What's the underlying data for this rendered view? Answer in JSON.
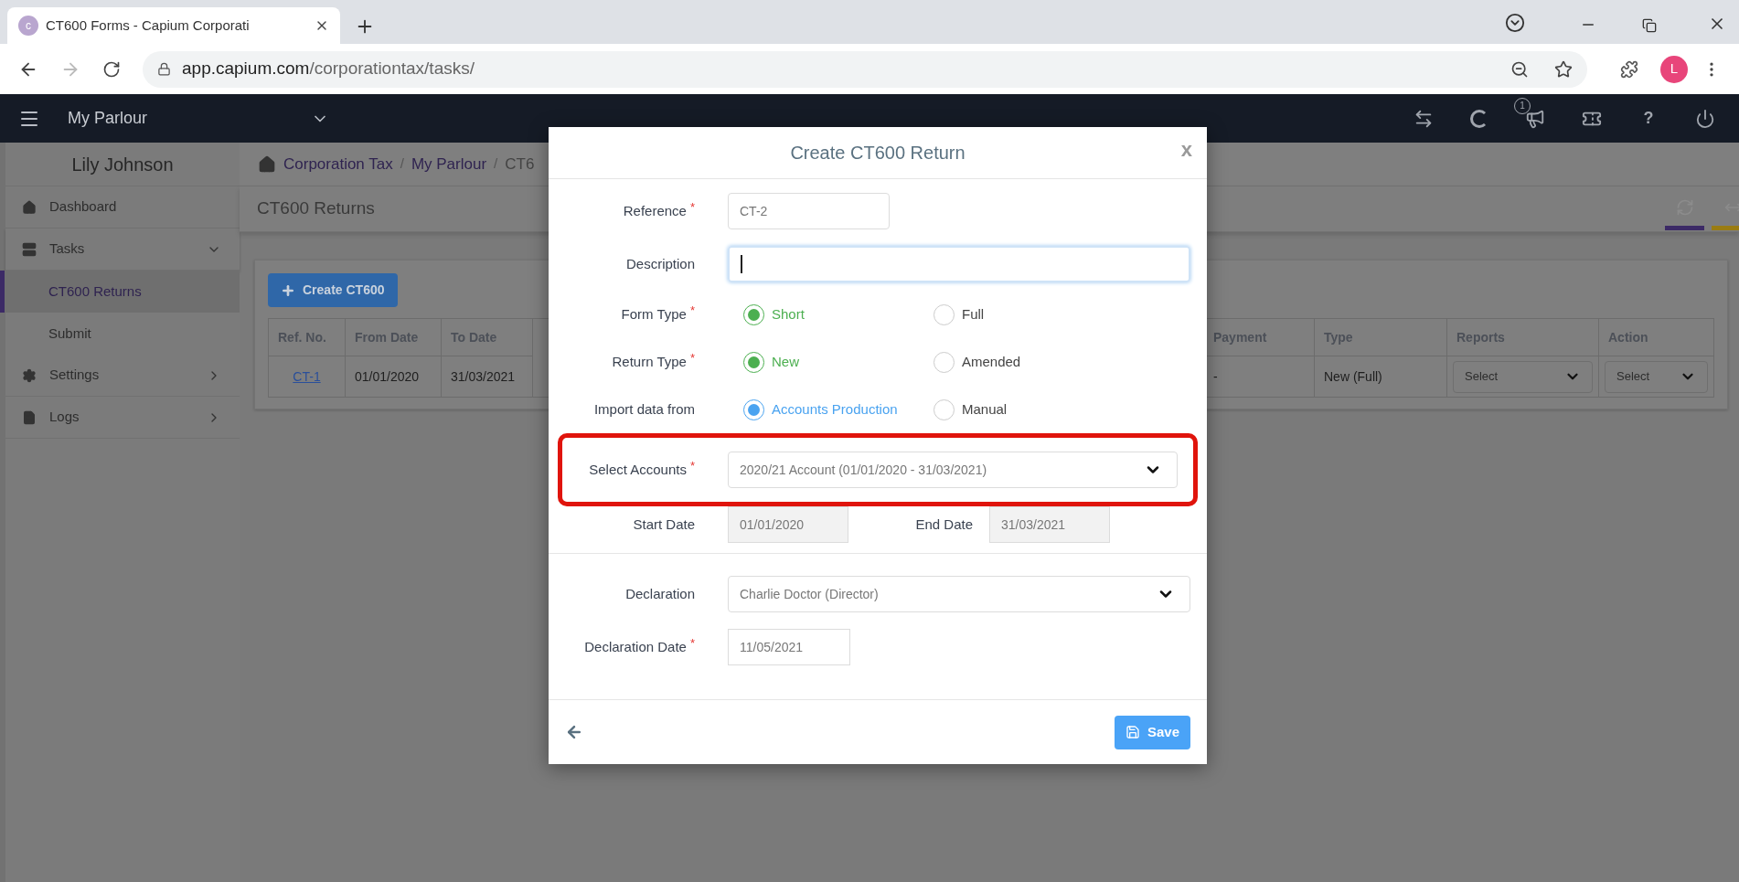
{
  "browser": {
    "tab_title": "CT600 Forms - Capium Corporati",
    "favicon_letter": "c",
    "address_domain": "app.capium.com",
    "address_path": "/corporationtax/tasks/",
    "profile_initial": "L"
  },
  "navbar": {
    "title": "My Parlour",
    "notification_count": "1",
    "help_label": "?"
  },
  "sidebar": {
    "user": "Lily Johnson",
    "items": [
      {
        "kind": "link",
        "label": "Dashboard"
      },
      {
        "kind": "group",
        "label": "Tasks",
        "expanded": true,
        "children": [
          {
            "label": "CT600 Returns",
            "selected": true
          },
          {
            "label": "Submit",
            "selected": false
          }
        ]
      },
      {
        "kind": "group",
        "label": "Settings",
        "expanded": false
      },
      {
        "kind": "group",
        "label": "Logs",
        "expanded": false
      }
    ]
  },
  "main": {
    "breadcrumb": [
      "Corporation Tax",
      "My Parlour",
      "CT6"
    ],
    "breadcrumb_separator": "/",
    "page_title": "CT600 Returns",
    "create_button": "Create CT600",
    "table": {
      "columns": [
        "Ref. No.",
        "From Date",
        "To Date",
        "Payment",
        "Type",
        "Reports",
        "Action"
      ],
      "rows": [
        {
          "ref": "CT-1",
          "from": "01/01/2020",
          "to": "31/03/2021",
          "payment": "-",
          "type": "New (Full)",
          "reports": "Select",
          "action": "Select"
        }
      ]
    }
  },
  "modal": {
    "title": "Create CT600 Return",
    "close": "x",
    "required_mark": "*",
    "sections": [
      [
        {
          "kind": "input",
          "label": "Reference",
          "required": true,
          "value": "CT-2",
          "focused": false
        },
        {
          "kind": "input",
          "label": "Description",
          "required": false,
          "focused": true
        },
        {
          "kind": "radio",
          "label": "Form Type",
          "required": true,
          "color": "#4caf50",
          "options": [
            {
              "label": "Short",
              "selected": true
            },
            {
              "label": "Full",
              "selected": false
            }
          ]
        },
        {
          "kind": "radio",
          "label": "Return Type",
          "required": true,
          "color": "#4caf50",
          "options": [
            {
              "label": "New",
              "selected": true
            },
            {
              "label": "Amended",
              "selected": false
            }
          ]
        },
        {
          "kind": "radio",
          "label": "Import data from",
          "required": false,
          "color": "#4aa3f0",
          "options": [
            {
              "label": "Accounts Production",
              "selected": true
            },
            {
              "label": "Manual",
              "selected": false
            }
          ]
        },
        {
          "kind": "select",
          "label": "Select Accounts",
          "required": true,
          "value": "2020/21 Account (01/01/2020 - 31/03/2021)",
          "highlighted": true
        },
        {
          "kind": "date_pair",
          "fields": [
            {
              "label": "Start Date",
              "value": "01/01/2020",
              "disabled": true
            },
            {
              "label": "End Date",
              "value": "31/03/2021",
              "disabled": true
            }
          ]
        }
      ],
      [
        {
          "kind": "select",
          "label": "Declaration",
          "required": false,
          "value": "Charlie Doctor (Director)",
          "highlighted": false
        },
        {
          "kind": "date",
          "label": "Declaration Date",
          "required": true,
          "value": "11/05/2021",
          "disabled": false
        }
      ]
    ],
    "save_button": "Save"
  }
}
